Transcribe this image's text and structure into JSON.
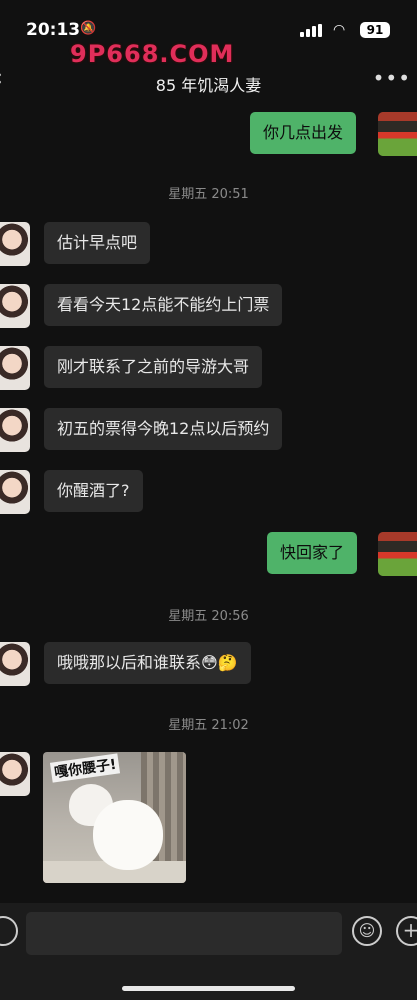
{
  "status_bar": {
    "time": "20:13",
    "battery": "91"
  },
  "watermark": "9P668.COM",
  "header": {
    "title": "85 年饥渴人妻",
    "back_icon": "back-chevron-icon",
    "more_icon": "more-dots-icon"
  },
  "messages": [
    {
      "side": "out",
      "text": "你几点出发"
    },
    {
      "side": "time",
      "text": "星期五 20:51"
    },
    {
      "side": "in",
      "text": "估计早点吧"
    },
    {
      "side": "in",
      "text": "看看今天12点能不能约上门票"
    },
    {
      "side": "in",
      "text": "刚才联系了之前的导游大哥"
    },
    {
      "side": "in",
      "text": "初五的票得今晚12点以后预约"
    },
    {
      "side": "in",
      "text": "你醒酒了?"
    },
    {
      "side": "out",
      "text": "快回家了"
    },
    {
      "side": "time",
      "text": "星期五 20:56"
    },
    {
      "side": "in",
      "text": "哦哦那以后和谁联系",
      "emoji": "😳🤔"
    },
    {
      "side": "time",
      "text": "星期五 21:02"
    },
    {
      "side": "in",
      "sticker_text": "嘎你腰子!"
    }
  ],
  "input_bar": {
    "voice_icon": "voice-icon",
    "emoji_icon": "emoji-icon",
    "plus_icon": "plus-icon"
  }
}
